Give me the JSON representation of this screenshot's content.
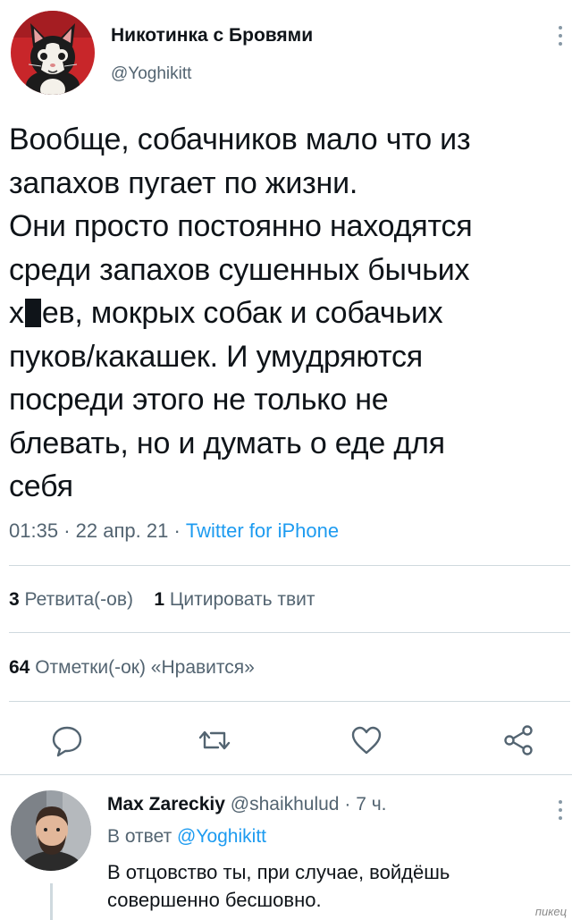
{
  "tweet": {
    "author": {
      "name": "Никотинка с Бровями",
      "handle": "@Yoghikitt"
    },
    "text_lines": {
      "l1": "Вообще, собачников мало что из",
      "l2": "запахов пугает по жизни.",
      "l3": "Они просто постоянно находятся",
      "l4": "среди запахов сушенных бычьих",
      "l5_a": "х",
      "l5_b": "ев, мокрых собак и собачьих",
      "l6": "пуков/какашек. И умудряются",
      "l7": "посреди этого не только не",
      "l8": "блевать, но и думать о еде для",
      "l9": "себя"
    },
    "time": "01:35",
    "date": "22 апр. 21",
    "separator": "·",
    "source": "Twitter for iPhone",
    "retweets": {
      "count": "3",
      "label": "Ретвита(-ов)"
    },
    "quotes": {
      "count": "1",
      "label": "Цитировать твит"
    },
    "likes": {
      "count": "64",
      "label": "Отметки(-ок) «Нравится»"
    }
  },
  "actions": {
    "reply_icon": "comment-icon",
    "retweet_icon": "retweet-icon",
    "like_icon": "heart-icon",
    "share_icon": "share-icon"
  },
  "reply": {
    "name": "Max Zareckiy",
    "handle": "@shaikhulud",
    "separator": "·",
    "age": "7 ч.",
    "in_reply_label": "В ответ",
    "in_reply_mention": "@Yoghikitt",
    "text_l1": "В отцовство ты, при случае, войдёшь",
    "text_l2": "совершенно бесшовно."
  },
  "watermark": "пикец",
  "colors": {
    "accent": "#1d9bf0",
    "muted": "#536471",
    "text": "#0f1419",
    "divider": "#cfd9de"
  }
}
